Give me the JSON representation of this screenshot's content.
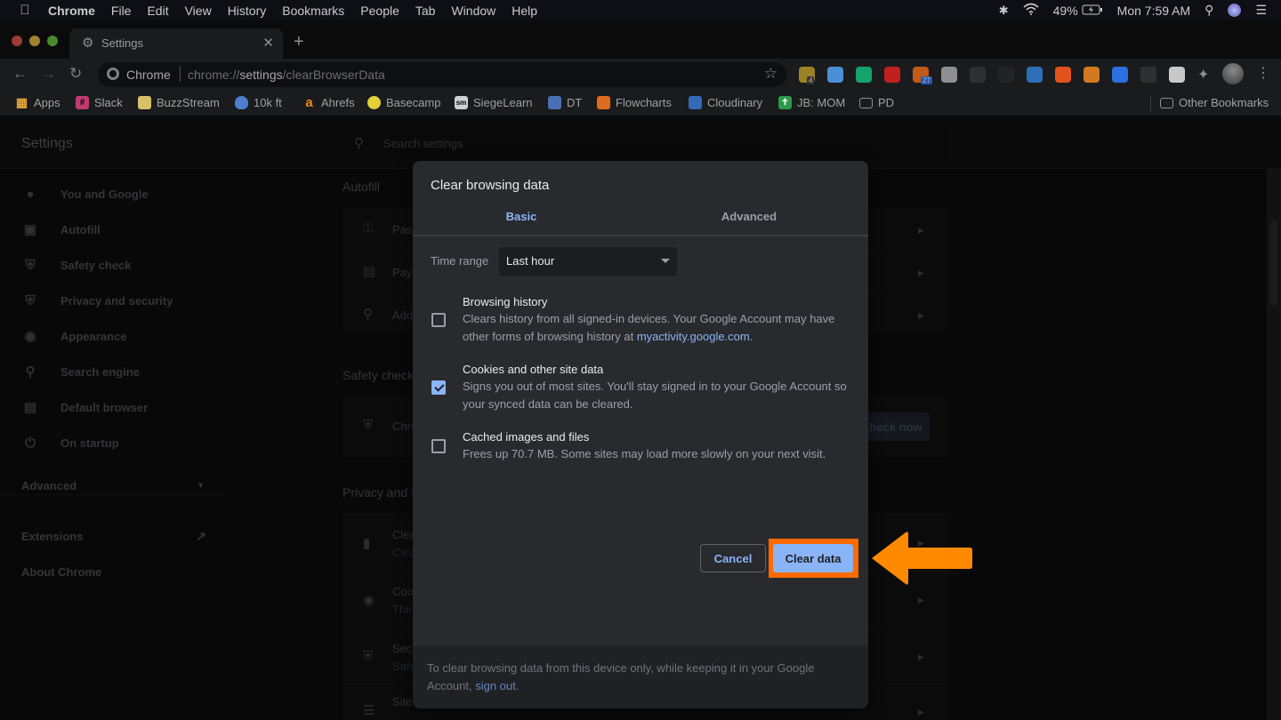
{
  "menubar": {
    "app_name": "Chrome",
    "items": [
      "File",
      "Edit",
      "View",
      "History",
      "Bookmarks",
      "People",
      "Tab",
      "Window",
      "Help"
    ],
    "battery": "49%",
    "clock": "Mon 7:59 AM"
  },
  "tabs": [
    {
      "label": "Settings",
      "icon": "gear-icon",
      "active": true
    }
  ],
  "omnibox": {
    "site_label": "Chrome",
    "url_prefix": "chrome://",
    "url_host": "settings",
    "url_path": "/clearBrowserData"
  },
  "extensions": [
    {
      "name": "notes-extension",
      "badge": "4",
      "color": "#9a8226"
    },
    {
      "name": "diamond-extension",
      "color": "#4b8ed6"
    },
    {
      "name": "grammarly-extension",
      "color": "#15a36c"
    },
    {
      "name": "adblock-extension",
      "color": "#c0211f"
    },
    {
      "name": "timer-extension",
      "badge": "27",
      "color": "#c45a19"
    },
    {
      "name": "link-extension",
      "color": "#8e8f92"
    },
    {
      "name": "recycle-extension",
      "color": "#2f3032"
    },
    {
      "name": "faded-extension",
      "color": "#222325"
    },
    {
      "name": "compass-extension",
      "color": "#2c6fb7"
    },
    {
      "name": "fox-extension",
      "color": "#e2531c"
    },
    {
      "name": "face-extension",
      "color": "#d27a20"
    },
    {
      "name": "zoom-extension",
      "color": "#2d6fe0"
    },
    {
      "name": "grid-extension",
      "color": "#2f3032"
    },
    {
      "name": "stripes-extension",
      "color": "#c8c8c8"
    }
  ],
  "bookmarks": {
    "items": [
      {
        "label": "Apps",
        "color": "#e3a73a"
      },
      {
        "label": "Slack",
        "color": "#c03c70"
      },
      {
        "label": "BuzzStream",
        "color": "#d9c16a"
      },
      {
        "label": "10k ft",
        "color": "#4c7fcf"
      },
      {
        "label": "Ahrefs",
        "color": "#f08a1a"
      },
      {
        "label": "Basecamp",
        "color": "#e3cf37"
      },
      {
        "label": "SiegeLearn",
        "color": "#d0d0d0"
      },
      {
        "label": "DT",
        "color": "#4a6fb5"
      },
      {
        "label": "Flowcharts",
        "color": "#e06a1e"
      },
      {
        "label": "Cloudinary",
        "color": "#3569b8"
      },
      {
        "label": "JB: MOM",
        "color": "#2c9a4a"
      },
      {
        "label": "PD",
        "color": "#8e8f92"
      }
    ],
    "other": "Other Bookmarks"
  },
  "settings": {
    "title": "Settings",
    "search_placeholder": "Search settings",
    "nav": [
      {
        "label": "You and Google",
        "icon": "person-icon"
      },
      {
        "label": "Autofill",
        "icon": "clipboard-icon"
      },
      {
        "label": "Safety check",
        "icon": "shield-check-icon"
      },
      {
        "label": "Privacy and security",
        "icon": "shield-half-icon"
      },
      {
        "label": "Appearance",
        "icon": "palette-icon"
      },
      {
        "label": "Search engine",
        "icon": "search-icon"
      },
      {
        "label": "Default browser",
        "icon": "browser-icon"
      },
      {
        "label": "On startup",
        "icon": "power-icon"
      }
    ],
    "advanced": "Advanced",
    "extensions": "Extensions",
    "about": "About Chrome",
    "sections": {
      "autofill": {
        "title": "Autofill",
        "rows": [
          "Passwords",
          "Payment methods",
          "Addresses and more"
        ]
      },
      "safety": {
        "title": "Safety check",
        "row": "Chrome can help keep you safe from data breaches, bad extensions, and more",
        "button": "Check now"
      },
      "privacy": {
        "title": "Privacy and security",
        "rows": [
          {
            "title": "Clear browsing data",
            "sub": "Clear history, cookies, cache, and more"
          },
          {
            "title": "Cookies and other site data",
            "sub": "Third-party cookies are blocked in Incognito mode"
          },
          {
            "title": "Security",
            "sub": "Safe Browsing (protection from dangerous sites) and other security settings"
          },
          {
            "title": "Site Settings",
            "sub": ""
          }
        ]
      }
    }
  },
  "dialog": {
    "title": "Clear browsing data",
    "tabs": {
      "basic": "Basic",
      "advanced": "Advanced",
      "active": "basic"
    },
    "time_range": {
      "label": "Time range",
      "value": "Last hour"
    },
    "options": [
      {
        "title": "Browsing history",
        "desc_before": "Clears history from all signed-in devices. Your Google Account may have other forms of browsing history at ",
        "link": "myactivity.google.com",
        "desc_after": ".",
        "checked": false
      },
      {
        "title": "Cookies and other site data",
        "desc": "Signs you out of most sites. You'll stay signed in to your Google Account so your synced data can be cleared.",
        "checked": true
      },
      {
        "title": "Cached images and files",
        "desc": "Frees up 70.7 MB. Some sites may load more slowly on your next visit.",
        "checked": false
      }
    ],
    "cancel": "Cancel",
    "confirm": "Clear data",
    "footer_before": "To clear browsing data from this device only, while keeping it in your Google Account, ",
    "footer_link": "sign out",
    "footer_after": "."
  },
  "annotation": {
    "color": "#ff8a00",
    "highlight_color": "#ff6a00",
    "target": "Clear data"
  }
}
